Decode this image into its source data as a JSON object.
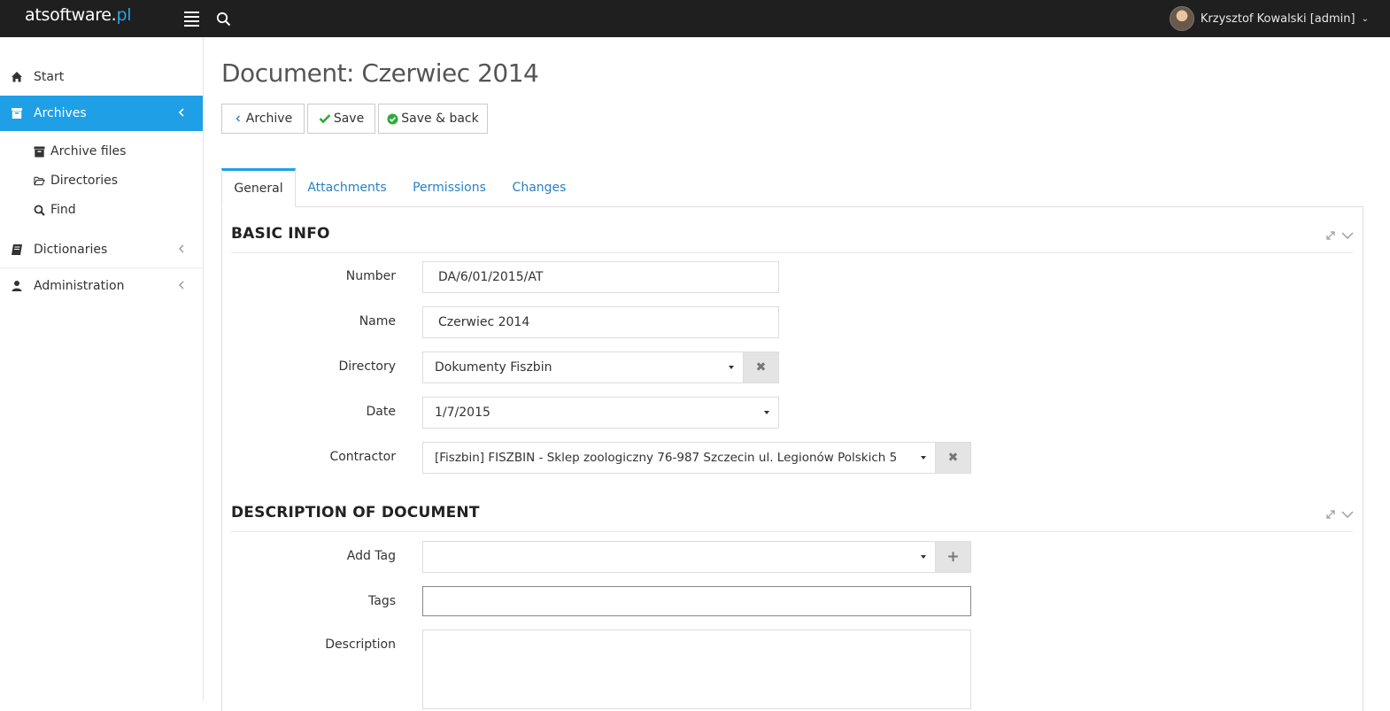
{
  "header": {
    "logo_main": "atsoftware.",
    "logo_accent": "pl",
    "user_name": "Krzysztof Kowalski [admin]"
  },
  "sidebar": {
    "items": [
      {
        "label": "Start",
        "icon": "home-icon"
      },
      {
        "label": "Archives",
        "icon": "archive-icon",
        "active": true
      },
      {
        "label": "Dictionaries",
        "icon": "book-icon"
      },
      {
        "label": "Administration",
        "icon": "user-icon"
      }
    ],
    "archives_sub": [
      {
        "label": "Archive files",
        "icon": "archive-icon"
      },
      {
        "label": "Directories",
        "icon": "folder-open-icon"
      },
      {
        "label": "Find",
        "icon": "search-icon"
      }
    ]
  },
  "page": {
    "title": "Document: Czerwiec 2014"
  },
  "toolbar": {
    "archive_label": "Archive",
    "save_label": "Save",
    "save_back_label": "Save & back"
  },
  "tabs": [
    {
      "label": "General",
      "active": true
    },
    {
      "label": "Attachments"
    },
    {
      "label": "Permissions"
    },
    {
      "label": "Changes"
    }
  ],
  "basic_info": {
    "title": "BASIC INFO",
    "number_label": "Number",
    "number_value": "DA/6/01/2015/AT",
    "name_label": "Name",
    "name_value": "Czerwiec 2014",
    "directory_label": "Directory",
    "directory_value": "Dokumenty Fiszbin",
    "date_label": "Date",
    "date_value": "1/7/2015",
    "contractor_label": "Contractor",
    "contractor_value": "[Fiszbin] FISZBIN - Sklep zoologiczny 76-987 Szczecin ul. Legionów Polskich 5"
  },
  "description": {
    "title": "DESCRIPTION OF DOCUMENT",
    "add_tag_label": "Add Tag",
    "add_tag_value": "",
    "tags_label": "Tags",
    "tags_value": "",
    "description_label": "Description",
    "description_value": ""
  },
  "colors": {
    "topbar": "#1f1f1f",
    "accent": "#1f9fe6",
    "link": "#2b7fc2",
    "save_check": "#2eaa3c"
  }
}
